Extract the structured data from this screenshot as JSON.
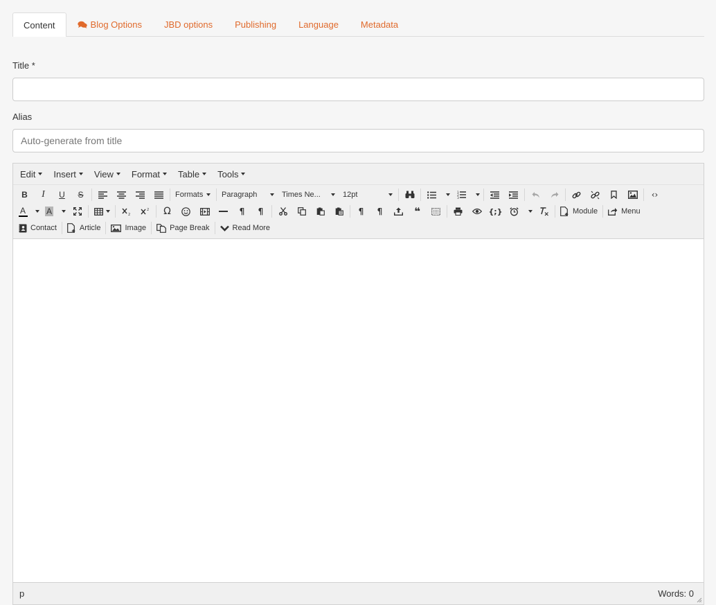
{
  "tabs": [
    {
      "label": "Content",
      "active": true
    },
    {
      "label": "Blog Options",
      "icon": "comments-icon"
    },
    {
      "label": "JBD options"
    },
    {
      "label": "Publishing"
    },
    {
      "label": "Language"
    },
    {
      "label": "Metadata"
    }
  ],
  "form": {
    "title_label": "Title *",
    "title_value": "",
    "alias_label": "Alias",
    "alias_placeholder": "Auto-generate from title"
  },
  "editor": {
    "menus": [
      "Edit",
      "Insert",
      "View",
      "Format",
      "Table",
      "Tools"
    ],
    "formats_label": "Formats",
    "block_format": "Paragraph",
    "font_family": "Times Ne...",
    "font_size": "12pt",
    "buttons": {
      "module": "Module",
      "menu": "Menu",
      "contact": "Contact",
      "article": "Article",
      "image": "Image",
      "page_break": "Page Break",
      "read_more": "Read More"
    },
    "glyphs": {
      "bold": "B",
      "italic": "I",
      "underline": "U",
      "strike": "S",
      "text_color": "A",
      "bg_color": "A",
      "special_char": "Ω",
      "code": "‹›",
      "print": "🖶",
      "template": "{;}",
      "pilcrow": "¶",
      "blockquote": "❝"
    },
    "status_path": "p",
    "word_count": "Words: 0"
  },
  "colors": {
    "accent": "#e06a2c",
    "toolbar_bg": "#f0f0f0",
    "page_bg": "#f6f6f6"
  }
}
